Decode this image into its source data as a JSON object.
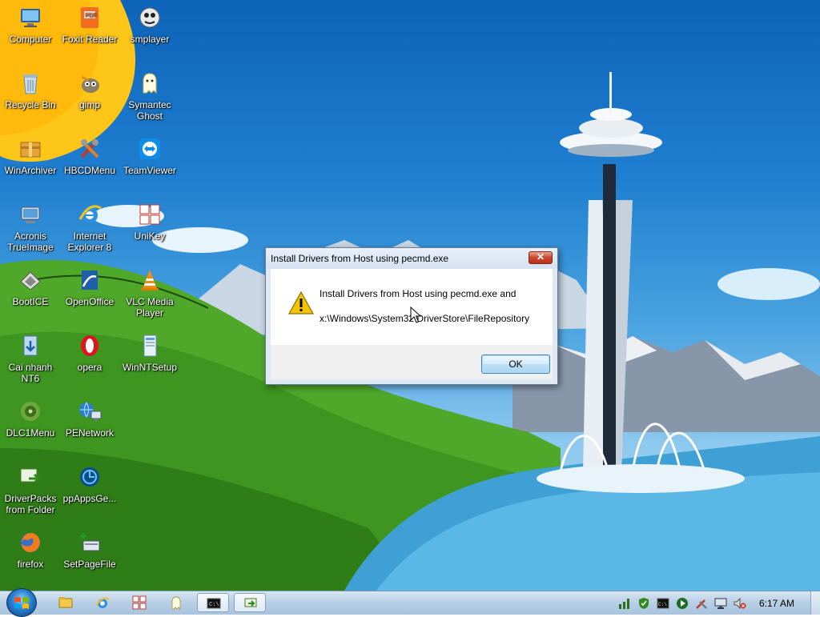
{
  "desktop": {
    "icons": [
      {
        "label": "Computer",
        "icon": "computer-icon"
      },
      {
        "label": "Foxit Reader",
        "icon": "pdf-icon"
      },
      {
        "label": "smplayer",
        "icon": "media-player-icon"
      },
      {
        "label": "Recycle Bin",
        "icon": "recycle-bin-icon"
      },
      {
        "label": "gimp",
        "icon": "gimp-icon"
      },
      {
        "label": "Symantec Ghost",
        "icon": "ghost-icon"
      },
      {
        "label": "WinArchiver",
        "icon": "archive-icon"
      },
      {
        "label": "HBCDMenu",
        "icon": "tools-icon"
      },
      {
        "label": "TeamViewer",
        "icon": "remote-control-icon"
      },
      {
        "label": "Acronis TrueImage",
        "icon": "backup-icon"
      },
      {
        "label": "Internet Explorer 8",
        "icon": "browser-icon"
      },
      {
        "label": "UniKey",
        "icon": "keyboard-icon"
      },
      {
        "label": "BootICE",
        "icon": "disk-icon"
      },
      {
        "label": "OpenOffice",
        "icon": "office-icon"
      },
      {
        "label": "VLC Media Player",
        "icon": "vlc-cone-icon"
      },
      {
        "label": "Cai nhanh NT6",
        "icon": "installer-icon"
      },
      {
        "label": "opera",
        "icon": "opera-icon"
      },
      {
        "label": "WinNTSetup",
        "icon": "setup-icon"
      },
      {
        "label": "DLC1Menu",
        "icon": "menu-disc-icon"
      },
      {
        "label": "PENetwork",
        "icon": "network-icon"
      },
      {
        "label": "DriverPacks from Folder",
        "icon": "driver-pack-icon"
      },
      {
        "label": "ppAppsGe...",
        "icon": "apps-icon"
      },
      {
        "label": "firefox",
        "icon": "firefox-icon"
      },
      {
        "label": "SetPageFile",
        "icon": "pagefile-icon"
      }
    ]
  },
  "dialog": {
    "title": "Install Drivers from Host using pecmd.exe",
    "close_label": "✕",
    "line1": "Install Drivers from Host using pecmd.exe and",
    "line2": "x:\\Windows\\System32\\DriverStore\\FileRepository",
    "ok_label": "OK"
  },
  "taskbar": {
    "pinned": [
      {
        "icon": "file-explorer-icon"
      },
      {
        "icon": "internet-explorer-icon"
      },
      {
        "icon": "unikey-icon"
      },
      {
        "icon": "ghost-icon"
      },
      {
        "icon": "command-prompt-icon",
        "active": true
      },
      {
        "icon": "driver-install-icon",
        "active": true
      }
    ],
    "tray": [
      {
        "icon": "network-icon"
      },
      {
        "icon": "security-shield-icon"
      },
      {
        "icon": "command-prompt-icon"
      },
      {
        "icon": "media-play-icon"
      },
      {
        "icon": "tools-icon"
      },
      {
        "icon": "monitor-icon"
      },
      {
        "icon": "volume-muted-icon"
      }
    ],
    "clock": "6:17 AM"
  },
  "colors": {
    "dialog_background": "#dfe9f5",
    "close_button": "#c9462b",
    "ok_button_border": "#3c7fb1",
    "taskbar": "#b9d0e6"
  }
}
